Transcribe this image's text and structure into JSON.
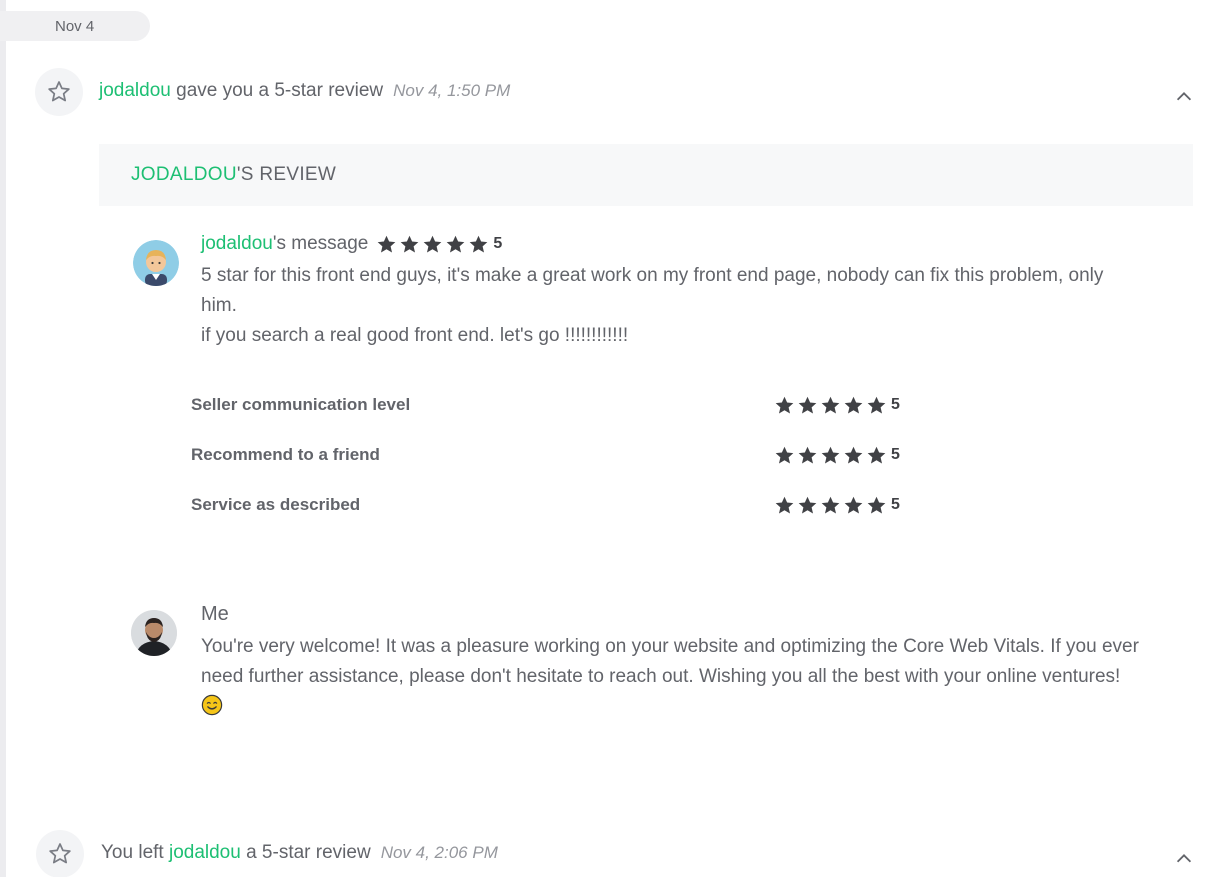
{
  "date_label": "Nov 4",
  "activity1": {
    "user": "jodaldou",
    "text": " gave you a 5-star review",
    "time": "Nov 4, 1:50 PM"
  },
  "review": {
    "header_user": "JODALDOU",
    "header_suffix": "'S REVIEW",
    "message_user": "jodaldou",
    "message_suffix": "'s message",
    "rating": "5",
    "message_line1": "5 star for this front end guys, it's make a great work on my front end page, nobody can fix this problem, only him.",
    "message_line2": "if you search a real good front end. let's go !!!!!!!!!!!!",
    "criteria": [
      {
        "label": "Seller communication level",
        "rating": "5"
      },
      {
        "label": "Recommend to a friend",
        "rating": "5"
      },
      {
        "label": "Service as described",
        "rating": "5"
      }
    ]
  },
  "reply": {
    "name": "Me",
    "text": "You're very welcome! It was a pleasure working on your website and optimizing the Core Web Vitals. If you ever need further assistance, please don't hesitate to reach out. Wishing you all the best with your online ventures!"
  },
  "activity2": {
    "prefix": "You left ",
    "user": "jodaldou",
    "suffix": " a 5-star review",
    "time": "Nov 4, 2:06 PM"
  },
  "icons": {
    "activity": "star-outline-icon",
    "collapse": "chevron-up-icon",
    "rating": "star-filled-icon"
  },
  "colors": {
    "accent": "#1dbf73",
    "text": "#62646a",
    "star": "#404145"
  }
}
